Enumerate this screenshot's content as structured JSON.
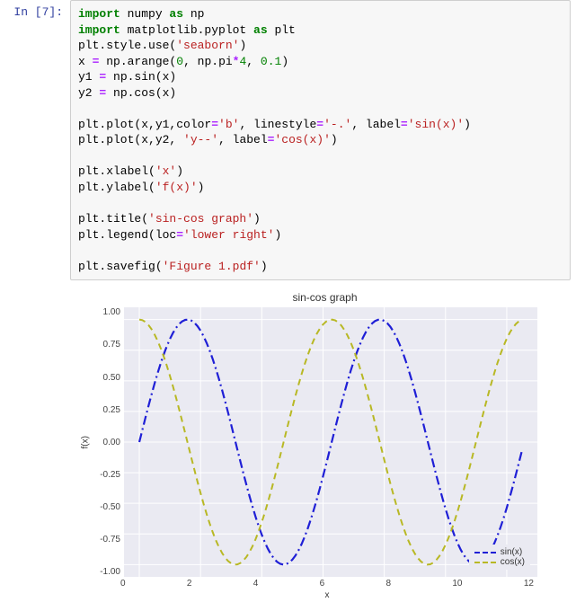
{
  "prompt": "In [7]:",
  "code": {
    "l01": {
      "a": "import",
      "b": " numpy ",
      "c": "as",
      "d": " np"
    },
    "l02": {
      "a": "import",
      "b": " matplotlib.pyplot ",
      "c": "as",
      "d": " plt"
    },
    "l03_a": "plt.style.use(",
    "l03_s": "'seaborn'",
    "l03_b": ")",
    "l04_a": "x ",
    "l04_eq": "=",
    "l04_b": " np.arange(",
    "l04_n1": "0",
    "l04_c": ", np.pi",
    "l04_op": "*",
    "l04_n2": "4",
    "l04_d": ", ",
    "l04_n3": "0.1",
    "l04_e": ")",
    "l05_a": "y1 ",
    "l05_eq": "=",
    "l05_b": " np.sin(x)",
    "l06_a": "y2 ",
    "l06_eq": "=",
    "l06_b": " np.cos(x)",
    "l08_a": "plt.plot(x,y1,color",
    "l08_eq1": "=",
    "l08_s1": "'b'",
    "l08_b": ", linestyle",
    "l08_eq2": "=",
    "l08_s2": "'-.'",
    "l08_c": ", label",
    "l08_eq3": "=",
    "l08_s3": "'sin(x)'",
    "l08_d": ")",
    "l09_a": "plt.plot(x,y2, ",
    "l09_s1": "'y--'",
    "l09_b": ", label",
    "l09_eq": "=",
    "l09_s2": "'cos(x)'",
    "l09_c": ")",
    "l11_a": "plt.xlabel(",
    "l11_s": "'x'",
    "l11_b": ")",
    "l12_a": "plt.ylabel(",
    "l12_s": "'f(x)'",
    "l12_b": ")",
    "l14_a": "plt.title(",
    "l14_s": "'sin-cos graph'",
    "l14_b": ")",
    "l15_a": "plt.legend(loc",
    "l15_eq": "=",
    "l15_s": "'lower right'",
    "l15_b": ")",
    "l17_a": "plt.savefig(",
    "l17_s": "'Figure 1.pdf'",
    "l17_b": ")"
  },
  "chart_data": {
    "type": "line",
    "title": "sin-cos graph",
    "xlabel": "x",
    "ylabel": "f(x)",
    "x_start": 0.0,
    "x_end": 12.5,
    "x_step": 0.1,
    "series": [
      {
        "name": "sin(x)",
        "fn": "sin",
        "color": "#1f1fd6",
        "style": "dashdot"
      },
      {
        "name": "cos(x)",
        "fn": "cos",
        "color": "#b8b824",
        "style": "dashed"
      }
    ],
    "xticks": [
      "0",
      "2",
      "4",
      "6",
      "8",
      "10",
      "12"
    ],
    "yticks": [
      "1.00",
      "0.75",
      "0.50",
      "0.25",
      "0.00",
      "-0.25",
      "-0.50",
      "-0.75",
      "-1.00"
    ],
    "xlim": [
      -0.5,
      13.0
    ],
    "ylim": [
      -1.1,
      1.1
    ],
    "legend_pos": "lower right"
  }
}
